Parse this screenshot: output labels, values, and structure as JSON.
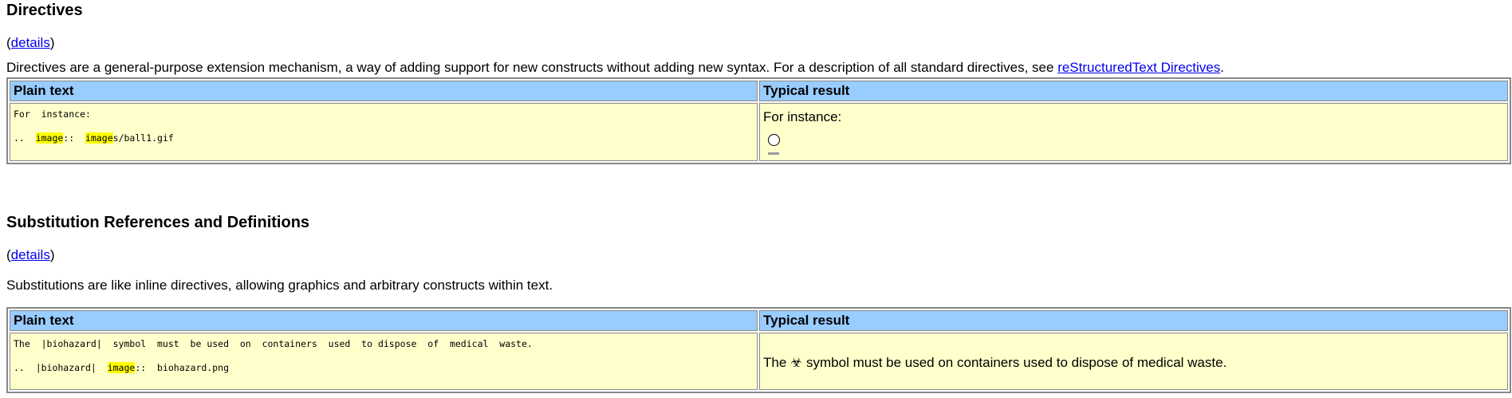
{
  "directives": {
    "title": "Directives",
    "details_open": "(",
    "details_link": "details",
    "details_close": ")",
    "description_prefix": "Directives are a general-purpose extension mechanism, a way of adding support for new constructs without adding new syntax. For a description of all standard directives, see ",
    "description_link": "reStructuredText Directives",
    "description_suffix": ".",
    "table": {
      "header_plain": "Plain text",
      "header_result": "Typical result",
      "plain_line1": "For  instance:",
      "plain_line2_prefix": "..  ",
      "plain_line2_hl1": "image",
      "plain_line2_mid": "::  ",
      "plain_line2_hl2": "image",
      "plain_line2_suffix": "s/ball1.gif",
      "result_text": "For instance:"
    }
  },
  "substitutions": {
    "title": "Substitution References and Definitions",
    "details_open": "(",
    "details_link": "details",
    "details_close": ")",
    "description": "Substitutions are like inline directives, allowing graphics and arbitrary constructs within text.",
    "table": {
      "header_plain": "Plain text",
      "header_result": "Typical result",
      "plain_line1": "The  |biohazard|  symbol  must  be used  on  containers  used  to dispose  of  medical  waste.",
      "plain_line2_prefix": "..  |biohazard|  ",
      "plain_line2_hl": "image",
      "plain_line2_suffix": "::  biohazard.png",
      "result_prefix": "The ",
      "result_symbol": "☣",
      "result_suffix": " symbol must be used on containers used to dispose of medical waste."
    }
  }
}
